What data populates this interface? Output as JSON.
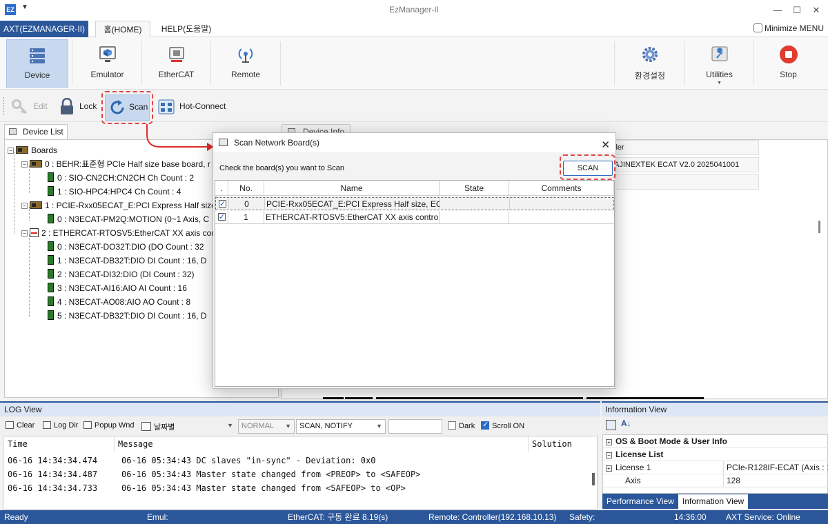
{
  "window": {
    "title": "EzManager-II",
    "app_icon": "EZ"
  },
  "ribbon_tabs": {
    "app": "AXT(EZMANAGER-II)",
    "home": "홈(HOME)",
    "help": "HELP(도움말)",
    "minimize_menu": "Minimize MENU"
  },
  "ribbon": {
    "device": "Device",
    "emulator": "Emulator",
    "ethercat": "EtherCAT",
    "remote": "Remote",
    "settings": "환경설정",
    "utilities": "Utilities",
    "stop": "Stop"
  },
  "toolbar": {
    "edit": "Edit",
    "lock": "Lock",
    "scan": "Scan",
    "hotconnect": "Hot-Connect"
  },
  "device_list": {
    "tab": "Device List",
    "items": [
      "Boards",
      "0 : BEHR:표준형 PCIe Half size base board, r",
      "0 : SIO-CN2CH:CN2CH Ch Count : 2",
      "1 : SIO-HPC4:HPC4 Ch Count : 4",
      "1 : PCIE-Rxx05ECAT_E:PCI Express Half size,",
      "0 : N3ECAT-PM2Q:MOTION (0~1 Axis, C",
      "2 : ETHERCAT-RTOSV5:EtherCAT XX axis cor",
      "0 : N3ECAT-DO32T:DIO (DO Count : 32",
      "1 : N3ECAT-DB32T:DIO DI Count : 16, D",
      "2 : N3ECAT-DI32:DIO (DI Count : 32)",
      "3 : N3ECAT-AI16:AIO AI Count : 16",
      "4 : N3ECAT-AO08:AIO AO Count : 8",
      "5 : N3ECAT-DB32T:DIO DI Count : 16, D"
    ]
  },
  "device_info": {
    "tab": "Device Info",
    "row1": "ller",
    "row2": "AJINEXTEK ECAT V2.0 2025041001"
  },
  "dialog": {
    "title": "Scan Network Board(s)",
    "instruction": "Check the board(s) you want to Scan",
    "scan_button": "SCAN",
    "columns": [
      ".",
      "No.",
      "Name",
      "State",
      "Comments"
    ],
    "rows": [
      {
        "checked": true,
        "no": "0",
        "name": "PCIE-Rxx05ECAT_E:PCI Express Half size, EC...",
        "state": "",
        "comments": ""
      },
      {
        "checked": true,
        "no": "1",
        "name": "ETHERCAT-RTOSV5:EtherCAT XX axis control...",
        "state": "",
        "comments": ""
      }
    ]
  },
  "log": {
    "title": "LOG View",
    "clear": "Clear",
    "log_dir": "Log Dir",
    "popup": "Popup Wnd",
    "date_sort": "날짜별",
    "level": "NORMAL",
    "filter": "SCAN, NOTIFY",
    "dark": "Dark",
    "scroll_on": "Scroll ON",
    "dark_checked": false,
    "scroll_on_checked": true,
    "col_time": "Time",
    "col_message": "Message",
    "col_solution": "Solution",
    "rows": [
      {
        "time": "06-16 14:34:34.474",
        "message": "06-16 05:34:43 DC slaves \"in-sync\" - Deviation: 0x0"
      },
      {
        "time": "06-16 14:34:34.487",
        "message": "06-16 05:34:43 Master state changed from <PREOP> to <SAFEOP>"
      },
      {
        "time": "06-16 14:34:34.733",
        "message": "06-16 05:34:43 Master state changed from <SAFEOP> to <OP>"
      }
    ]
  },
  "info": {
    "title": "Information View",
    "rows": {
      "os_boot": "OS & Boot Mode & User Info",
      "license_list": "License List",
      "license1": "License 1",
      "license1_val": "PCIe-R128IF-ECAT (Axis : 12",
      "axis": "Axis",
      "axis_val": "128"
    },
    "tab_perf": "Performance View",
    "tab_info": "Information View"
  },
  "status": {
    "ready": "Ready",
    "emul": "Emul:",
    "ethercat": "EtherCAT: 구동 완료 8.19(s)",
    "remote": "Remote: Controller(192.168.10.13)",
    "safety": "Safety:",
    "time": "14:36:00",
    "service": "AXT Service: Online"
  },
  "colors": {
    "accent": "#2b579a",
    "highlight": "#e04545",
    "selected_button": "#c8d9ef"
  }
}
